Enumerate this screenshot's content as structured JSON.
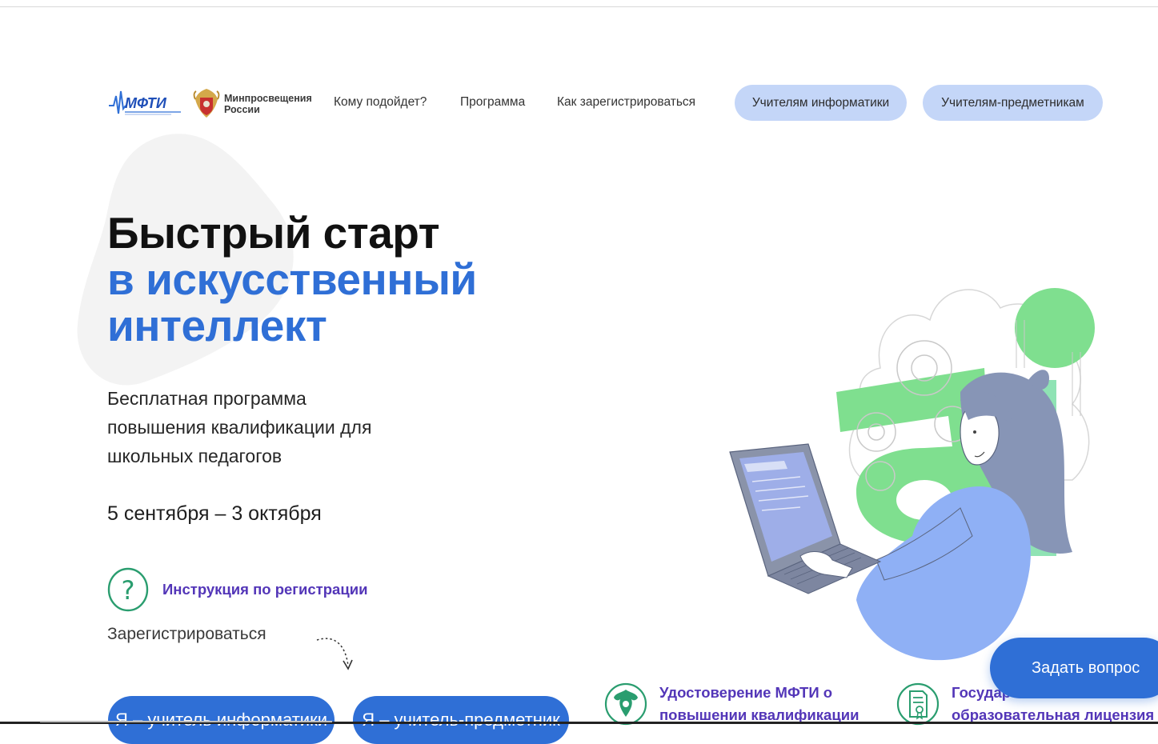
{
  "header": {
    "logo_mipt_text": "МФТИ",
    "logo_ministry_line1": "Минпросвещения",
    "logo_ministry_line2": "России",
    "nav": [
      "Кому подойдет?",
      "Программа",
      "Как зарегистрироваться"
    ],
    "pill_buttons": [
      "Учителям информатики",
      "Учителям-предметникам"
    ]
  },
  "hero": {
    "title_line1": "Быстрый старт",
    "title_line2": "в искусственный",
    "title_line3": "интеллект",
    "subtitle_line1": "Бесплатная программа",
    "subtitle_line2": "повышения квалификации для",
    "subtitle_line3": "школьных педагогов",
    "dates": "5 сентября – 3 октября",
    "help_link": "Инструкция по регистрации",
    "register_label": "Зарегистрироваться",
    "cta_buttons": [
      "Я – учитель информатики",
      "Я – учитель-предметник"
    ],
    "illustration_letters": "ai"
  },
  "features": {
    "certificate_line1": "Удостоверение МФТИ о",
    "certificate_line2": "повышении квалификации",
    "license_line1": "Государ",
    "license_line2": "образовательная лицензия"
  },
  "ask_button": "Задать вопрос",
  "colors": {
    "accent_blue": "#2f6fd6",
    "pill_blue": "#c4d6f8",
    "link_purple": "#5336b8",
    "icon_green": "#2a9d6f",
    "illus_green": "#7fdf8f"
  },
  "icons": {
    "mipt_logo": "mipt-logo-icon",
    "ministry_emblem": "ministry-emblem-icon",
    "help": "question-circle-icon",
    "arrow": "curved-arrow-down-icon",
    "certificate": "eagle-emblem-icon",
    "license": "document-license-icon"
  }
}
